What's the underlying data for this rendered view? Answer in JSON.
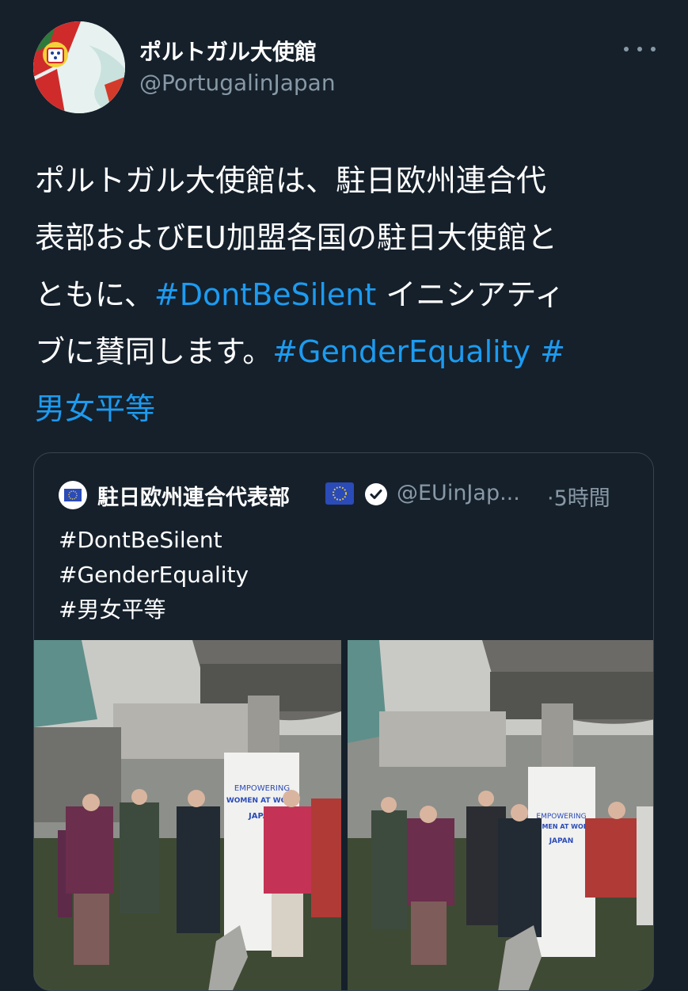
{
  "tweet": {
    "display_name": "ポルトガル大使館",
    "handle": "@PortugalinJapan",
    "text_line1": "ポルトガル大使館は、駐日欧州連合代",
    "text_line2": "表部およびEU加盟各国の駐日大使館と",
    "text_line3_pre": "ともに、",
    "hashtag_dontbesilent": "#DontBeSilent",
    "text_line3_post": " イニシアティ",
    "text_line4_pre": "ブに賛同します。",
    "hashtag_genderequality": "#GenderEquality",
    "hashtag_prefix": " #",
    "hashtag_danjo": "男女平等"
  },
  "quote": {
    "name": "駐日欧州連合代表部",
    "handle": "@EUinJap...",
    "time": "·5時間",
    "lines": [
      "#DontBeSilent",
      "#GenderEquality",
      "#男女平等"
    ],
    "banner": {
      "line1": "EMPOWERING",
      "line2": "WOMEN AT WORK",
      "line3": "JAPAN"
    }
  },
  "colors": {
    "background": "#15202b",
    "text": "#ffffff",
    "secondary": "#8899a6",
    "link": "#1d9bf0",
    "border": "#38444d"
  },
  "icons": [
    "more-icon",
    "eu-flag-icon",
    "verified-badge-icon",
    "avatar-portugal-flag"
  ]
}
